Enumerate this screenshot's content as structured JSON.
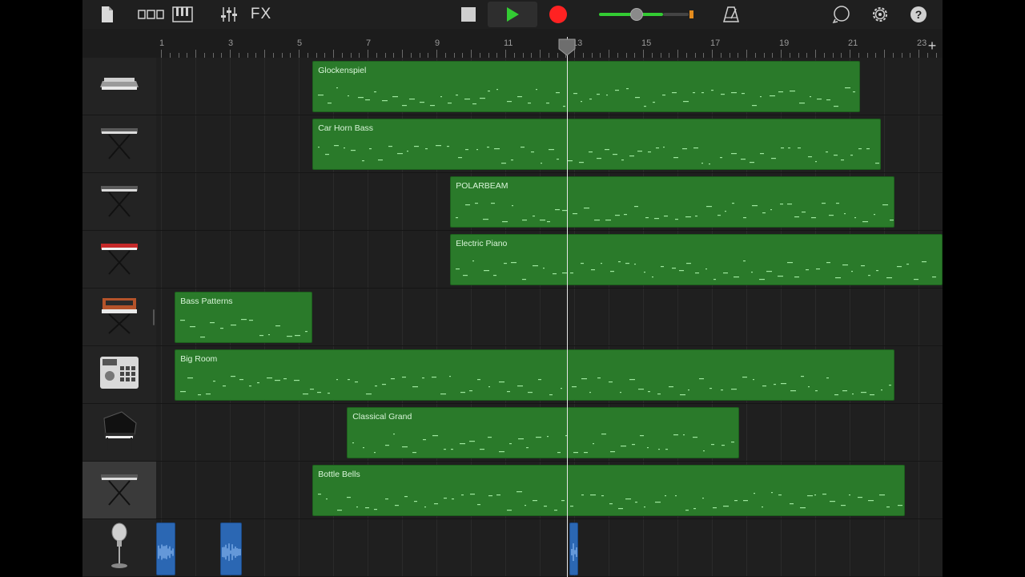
{
  "toolbar": {
    "fx_label": "FX",
    "icons": [
      "document-icon",
      "tracks-view-icon",
      "piano-keys-icon",
      "mixer-icon",
      "fx-icon",
      "stop-icon",
      "play-icon",
      "record-icon",
      "volume-slider",
      "metronome-icon",
      "loop-icon",
      "settings-gear-icon",
      "help-icon"
    ],
    "master_volume_fraction": 0.42,
    "colors": {
      "play": "#33cc33",
      "record": "#ff2222",
      "volume": "#33cc33",
      "meter": "#e38b1d"
    }
  },
  "ruler": {
    "bar_numbers": [
      "1",
      "3",
      "5",
      "7",
      "9",
      "11",
      "13",
      "15",
      "17",
      "19",
      "21",
      "23"
    ],
    "playhead_bar": 12.8
  },
  "tracks": [
    {
      "instrument": "keyboard-synth-icon",
      "region": {
        "name": "Glockenspiel",
        "start_bar": 5.4,
        "end_bar": 21.3,
        "kind": "midi"
      }
    },
    {
      "instrument": "keyboard-stand-icon",
      "region": {
        "name": "Car Horn Bass",
        "start_bar": 5.4,
        "end_bar": 21.9,
        "kind": "midi"
      }
    },
    {
      "instrument": "keyboard-stand-icon",
      "region": {
        "name": "POLARBEAM",
        "start_bar": 9.4,
        "end_bar": 22.3,
        "kind": "midi"
      }
    },
    {
      "instrument": "red-keyboard-icon",
      "region": {
        "name": "Electric Piano",
        "start_bar": 9.4,
        "end_bar": 23.8,
        "kind": "midi"
      }
    },
    {
      "instrument": "analog-synth-icon",
      "region": {
        "name": "Bass Patterns",
        "start_bar": 1.4,
        "end_bar": 5.4,
        "kind": "midi"
      }
    },
    {
      "instrument": "drum-machine-icon",
      "region": {
        "name": "Big Room",
        "start_bar": 1.4,
        "end_bar": 22.3,
        "kind": "midi"
      }
    },
    {
      "instrument": "grand-piano-icon",
      "region": {
        "name": "Classical Grand",
        "start_bar": 6.4,
        "end_bar": 17.8,
        "kind": "midi"
      }
    },
    {
      "instrument": "keyboard-stand-icon",
      "selected": true,
      "region": {
        "name": "Bottle Bells",
        "start_bar": 5.4,
        "end_bar": 22.6,
        "kind": "midi"
      }
    },
    {
      "instrument": "microphone-icon",
      "audio_regions": [
        {
          "start_bar": 1.0,
          "end_bar": 1.55
        },
        {
          "start_bar": 2.85,
          "end_bar": 3.5
        },
        {
          "start_bar": 13.0,
          "end_bar": 13.25
        }
      ]
    }
  ],
  "colors": {
    "midi_region": "#2a7a2a",
    "audio_region": "#2b67b3",
    "region_text": "#d9f5d9"
  }
}
